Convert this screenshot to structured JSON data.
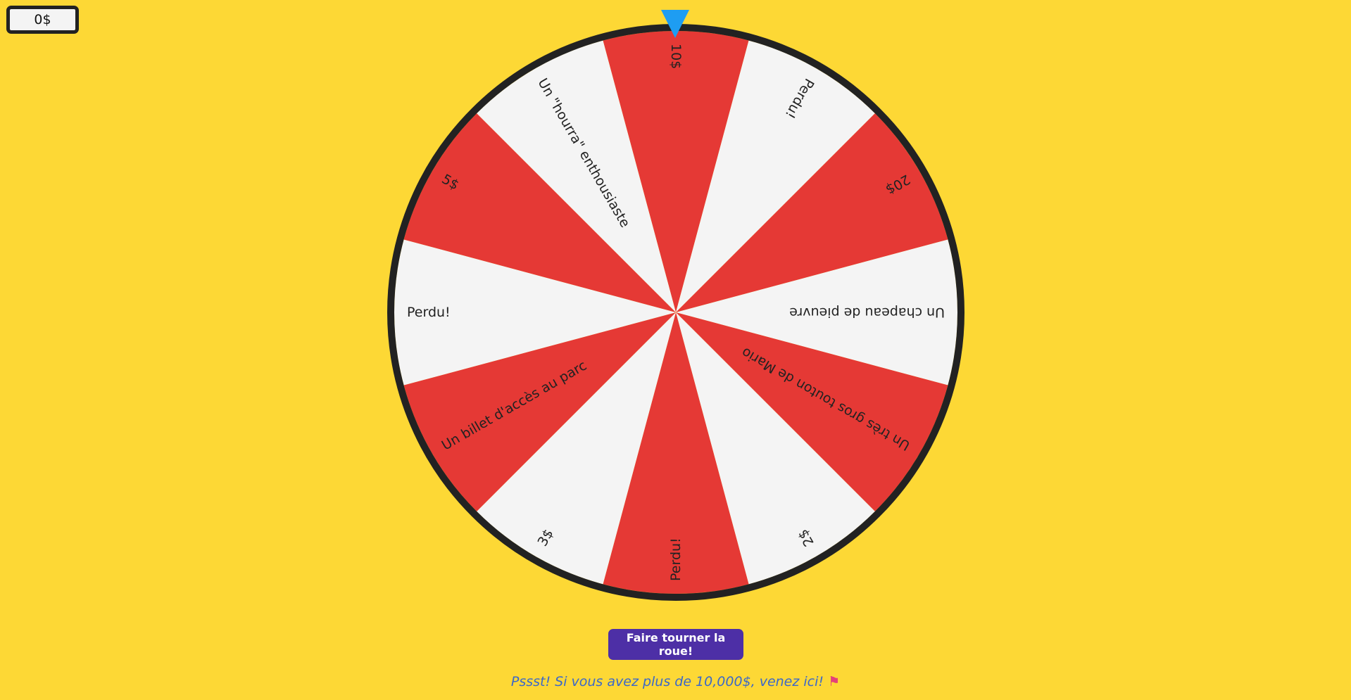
{
  "balance": {
    "value": "0$"
  },
  "wheel": {
    "colors": {
      "red": "#e53935",
      "white": "#f4f4f4",
      "rim": "#222222",
      "text": "#222222"
    },
    "segments": [
      {
        "label": "10$",
        "color": "red"
      },
      {
        "label": "Perdu!",
        "color": "white"
      },
      {
        "label": "20$",
        "color": "red"
      },
      {
        "label": "Un chapeau de pieuvre",
        "color": "white"
      },
      {
        "label": "Un très gros touton de Mario",
        "color": "red"
      },
      {
        "label": "2$",
        "color": "white"
      },
      {
        "label": "Perdu!",
        "color": "red"
      },
      {
        "label": "3$",
        "color": "white"
      },
      {
        "label": "Un billet d'accès au parc",
        "color": "red"
      },
      {
        "label": "Perdu!",
        "color": "white"
      },
      {
        "label": "5$",
        "color": "red"
      },
      {
        "label": "Un \"hourra\" enthousiaste",
        "color": "white"
      }
    ]
  },
  "pointer": {
    "icon": "triangle-down",
    "color": "#1e9df2"
  },
  "spin_button": {
    "label": "Faire tourner la roue!"
  },
  "promo": {
    "text": "Pssst! Si vous avez plus de 10,000$, venez ici!",
    "icon": "flag-icon"
  }
}
